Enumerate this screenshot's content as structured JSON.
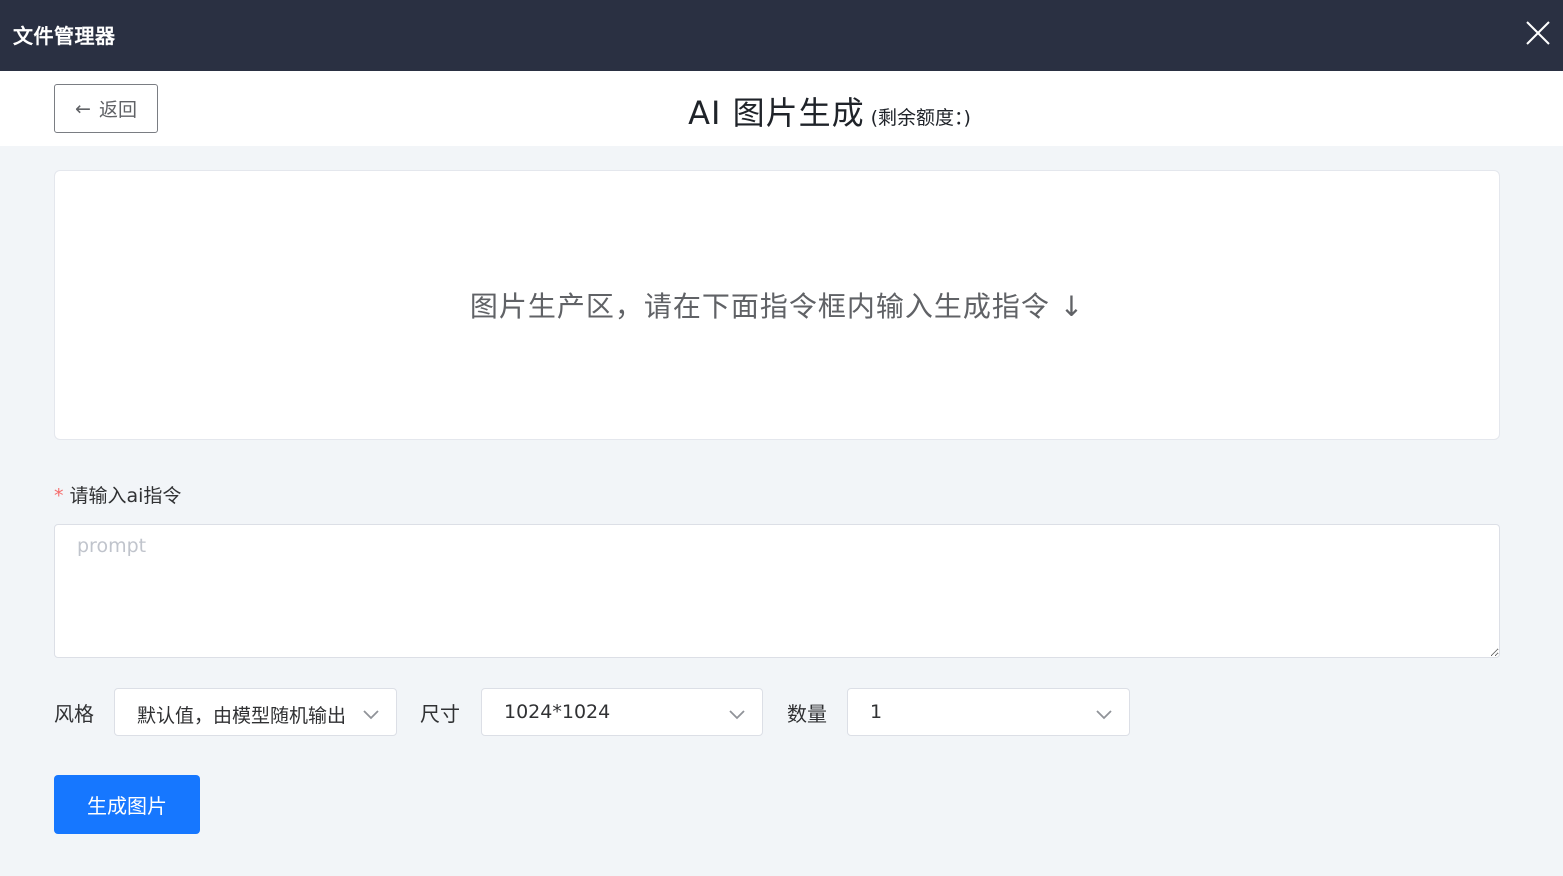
{
  "window": {
    "title": "文件管理器",
    "close_icon": "close-icon"
  },
  "header": {
    "back_label": "返回",
    "back_icon": "arrow-left-icon",
    "title": "AI 图片生成",
    "quota_text": "(剩余额度：)"
  },
  "preview": {
    "hint": "图片生产区，请在下面指令框内输入生成指令 ↓"
  },
  "prompt": {
    "label": "请输入ai指令",
    "required_mark": "*",
    "placeholder": "prompt",
    "value": ""
  },
  "options": {
    "style": {
      "label": "风格",
      "value": "默认值，由模型随机输出"
    },
    "size": {
      "label": "尺寸",
      "value": "1024*1024"
    },
    "count": {
      "label": "数量",
      "value": "1"
    }
  },
  "actions": {
    "generate_label": "生成图片"
  },
  "colors": {
    "titlebar": "#2a3042",
    "primary": "#1677ff",
    "required": "#f56c6c",
    "page_bg": "#f2f5f8"
  }
}
